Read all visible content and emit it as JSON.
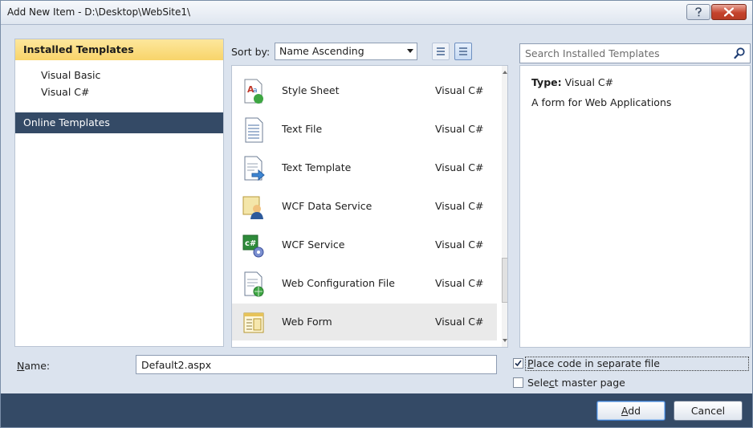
{
  "window": {
    "title": "Add New Item - D:\\Desktop\\WebSite1\\"
  },
  "left_pane": {
    "installed_header": "Installed Templates",
    "items": [
      "Visual Basic",
      "Visual C#"
    ],
    "online_header": "Online Templates"
  },
  "sort": {
    "label": "Sort by:",
    "selected": "Name Ascending"
  },
  "templates": [
    {
      "name": "Style Sheet",
      "language": "Visual C#",
      "icon": "style-sheet-icon"
    },
    {
      "name": "Text File",
      "language": "Visual C#",
      "icon": "text-file-icon"
    },
    {
      "name": "Text Template",
      "language": "Visual C#",
      "icon": "text-template-icon"
    },
    {
      "name": "WCF Data Service",
      "language": "Visual C#",
      "icon": "wcf-data-service-icon"
    },
    {
      "name": "WCF Service",
      "language": "Visual C#",
      "icon": "wcf-service-icon"
    },
    {
      "name": "Web Configuration File",
      "language": "Visual C#",
      "icon": "web-config-icon"
    },
    {
      "name": "Web Form",
      "language": "Visual C#",
      "icon": "web-form-icon",
      "selected": true
    }
  ],
  "search": {
    "placeholder": "Search Installed Templates"
  },
  "details": {
    "type_label": "Type:",
    "type_value": "Visual C#",
    "description": "A form for Web Applications"
  },
  "name": {
    "label_underlined": "N",
    "label_rest": "ame:",
    "value": "Default2.aspx"
  },
  "options": {
    "separate_code": {
      "label_underlined": "P",
      "label_rest": "lace code in separate file",
      "checked": true
    },
    "master_page": {
      "label_pre": "Sele",
      "label_underlined": "c",
      "label_rest": "t master page",
      "checked": false
    }
  },
  "buttons": {
    "add_underlined": "A",
    "add_rest": "dd",
    "cancel": "Cancel"
  },
  "colors": {
    "accent_header": "#f8d46a",
    "dark_band": "#344a66",
    "selected_row": "#eaeaea"
  }
}
